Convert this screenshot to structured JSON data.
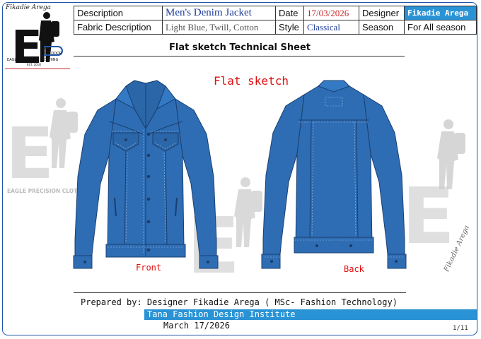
{
  "logo": {
    "script_text": "Fikadie Arega",
    "out_door": "OUT DOOR",
    "name": "EAGLE PRECISION CLOTHING",
    "est": "EST. 2018"
  },
  "header": {
    "description_label": "Description",
    "description_value": "Men's Denim Jacket",
    "date_label": "Date",
    "date_value": "17/03/2026",
    "designer_label": "Designer",
    "designer_value": "Fikadie Arega",
    "fabric_label": "Fabric Description",
    "fabric_value": "Light Blue, Twill, Cotton",
    "style_label": "Style",
    "style_value": "Classical",
    "season_label": "Season",
    "season_value": "For All season"
  },
  "sheet_title": "Flat sketch Technical Sheet",
  "flat_sketch_label": "Flat sketch",
  "views": {
    "front": "Front",
    "back": "Back"
  },
  "footer": {
    "prepared_by": "Prepared by: Designer Fikadie Arega ( MSc- Fashion Technology)",
    "institute": "Tana Fashion Design Institute",
    "date": "March 17/2026",
    "page": "1/11"
  },
  "colors": {
    "accent": "#2a93d5",
    "denim": "#2e6db4",
    "denim_dark": "#1d4f8c",
    "red_label": "#e01010"
  }
}
